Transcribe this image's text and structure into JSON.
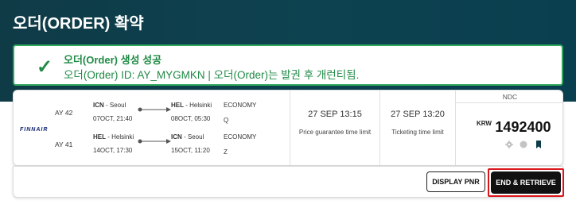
{
  "page": {
    "title": "오더(ORDER) 확약"
  },
  "toast": {
    "check_icon": "check-icon",
    "title": "오더(Order) 생성 성공",
    "message": "오더(Order) ID: AY_MYGMKN | 오더(Order)는 발권 후 개런티됨.",
    "accent_color": "#1f8a45"
  },
  "offer": {
    "airline_logo_text": "FINNAIR",
    "legs": [
      {
        "flight_no": "AY 42",
        "dep_code": "ICN",
        "dep_city": "Seoul",
        "dep_time": "07OCT, 21:40",
        "arr_code": "HEL",
        "arr_city": "Helsinki",
        "arr_time": "08OCT, 05:30",
        "cabin": "ECONOMY",
        "class": "Q"
      },
      {
        "flight_no": "AY 41",
        "dep_code": "HEL",
        "dep_city": "Helsinki",
        "dep_time": "14OCT, 17:30",
        "arr_code": "ICN",
        "arr_city": "Seoul",
        "arr_time": "15OCT, 11:20",
        "cabin": "ECONOMY",
        "class": "Z"
      }
    ],
    "price_guarantee": {
      "time": "27 SEP 13:15",
      "label": "Price guarantee time limit"
    },
    "ticketing": {
      "time": "27 SEP 13:20",
      "label": "Ticketing time limit"
    },
    "ndc_label": "NDC",
    "currency": "KRW",
    "amount": "1492400",
    "icons": [
      "gear-icon",
      "info-icon",
      "bookmark-icon"
    ]
  },
  "actions": {
    "display_pnr": "DISPLAY PNR",
    "end_retrieve": "END & RETRIEVE"
  }
}
